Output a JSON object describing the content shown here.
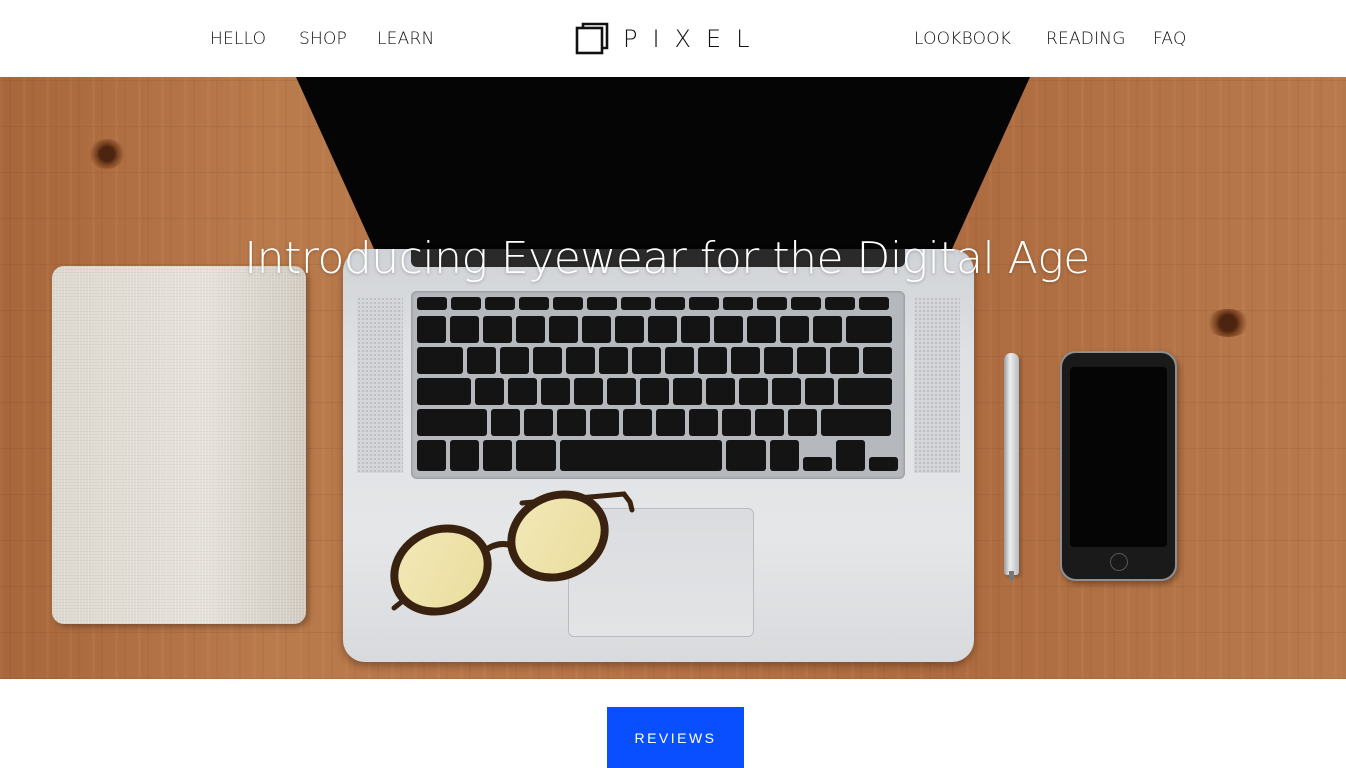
{
  "nav": {
    "left": [
      "HELLO",
      "SHOP",
      "LEARN"
    ],
    "right": [
      "LOOKBOOK",
      "READING",
      "FAQ"
    ]
  },
  "logo": {
    "text": "PIXEL"
  },
  "hero": {
    "title": "Introducing Eyewear for the Digital Age",
    "image_description_icon": "desk-scene-image"
  },
  "cta": {
    "label": "REVIEWS"
  },
  "colors": {
    "accent": "#0a4fff",
    "text": "#111111",
    "hero_text": "#ffffff",
    "wood": "#b27446"
  }
}
